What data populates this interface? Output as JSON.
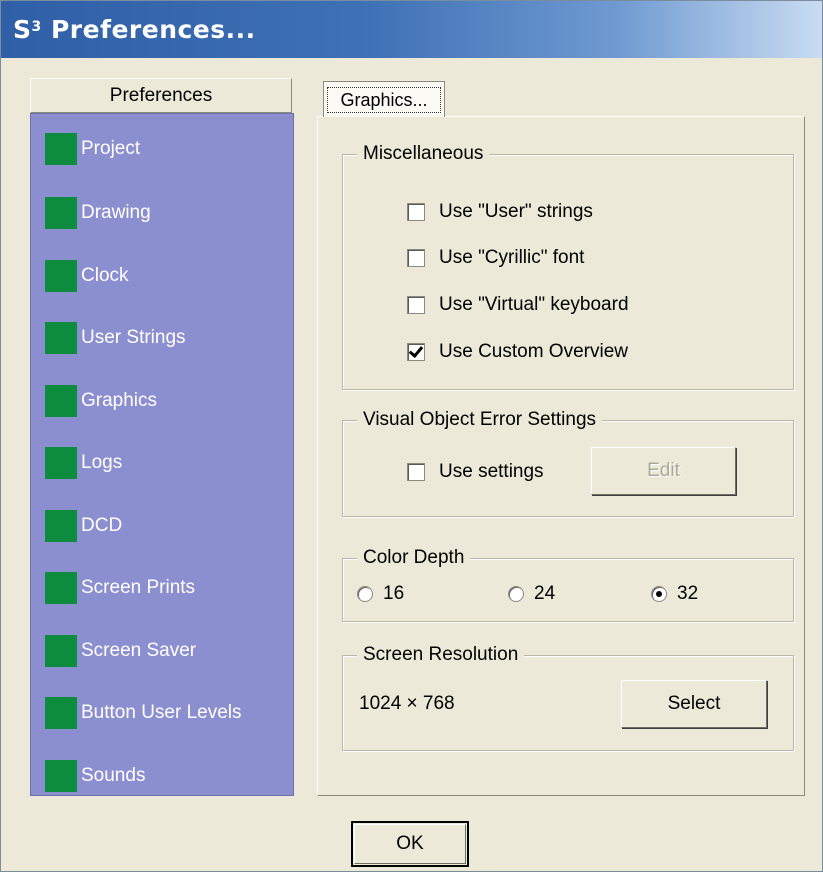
{
  "window": {
    "title_main": "S",
    "title_sup": "3",
    "title_rest": " Preferences..."
  },
  "sidebar": {
    "header": "Preferences",
    "items": [
      {
        "label": "Project"
      },
      {
        "label": "Drawing"
      },
      {
        "label": "Clock"
      },
      {
        "label": "User Strings"
      },
      {
        "label": "Graphics"
      },
      {
        "label": "Logs"
      },
      {
        "label": "DCD"
      },
      {
        "label": "Screen Prints"
      },
      {
        "label": "Screen Saver"
      },
      {
        "label": "Button User Levels"
      },
      {
        "label": "Sounds"
      }
    ]
  },
  "tab": {
    "label": "Graphics..."
  },
  "misc": {
    "legend": "Miscellaneous",
    "options": [
      {
        "label": "Use \"User\" strings",
        "checked": false
      },
      {
        "label": "Use \"Cyrillic\" font",
        "checked": false
      },
      {
        "label": "Use \"Virtual\" keyboard",
        "checked": false
      },
      {
        "label": "Use Custom Overview",
        "checked": true
      }
    ]
  },
  "voe": {
    "legend": "Visual Object Error Settings",
    "use_label": "Use settings",
    "use_checked": false,
    "edit_label": "Edit"
  },
  "color_depth": {
    "legend": "Color Depth",
    "options": [
      {
        "label": "16",
        "selected": false
      },
      {
        "label": "24",
        "selected": false
      },
      {
        "label": "32",
        "selected": true
      }
    ]
  },
  "screen_res": {
    "legend": "Screen Resolution",
    "value": "1024 × 768",
    "select_label": "Select"
  },
  "footer": {
    "ok_label": "OK"
  },
  "colors": {
    "sidebar_bg": "#8c8fcf",
    "nav_square": "#0c8c3c",
    "dialog_bg": "#ece9d8"
  }
}
